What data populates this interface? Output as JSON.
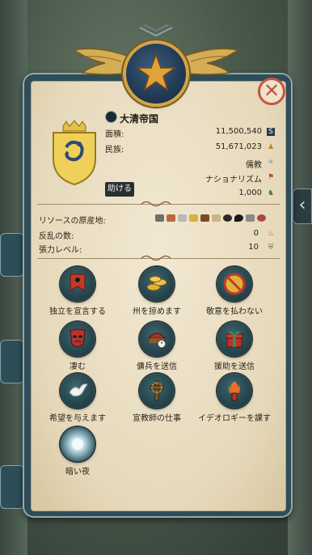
{
  "nation": {
    "name": "大清帝国",
    "help_button": "助ける"
  },
  "stats": [
    {
      "label": "面積:",
      "value": "11,500,540",
      "icon": "area-icon"
    },
    {
      "label": "民族:",
      "value": "51,671,023",
      "icon": "population-icon"
    },
    {
      "label": "",
      "value": "儒教",
      "icon": "religion-icon"
    },
    {
      "label": "",
      "value": "ナショナリズム",
      "icon": "ideology-flag-icon"
    },
    {
      "label": "",
      "value": "1,000",
      "icon": "army-icon"
    }
  ],
  "resources": {
    "label": "リソースの原産地:",
    "items": [
      "iron",
      "copper",
      "silver",
      "gold",
      "wood",
      "cloth",
      "coal",
      "oil",
      "stone",
      "meat"
    ]
  },
  "rebellion": {
    "label": "反乱の数:",
    "value": "0"
  },
  "power": {
    "label": "張力レベル:",
    "value": "10"
  },
  "actions": [
    {
      "label": "独立を宣言する",
      "icon": "banner-icon"
    },
    {
      "label": "州を掠めます",
      "icon": "coins-icon"
    },
    {
      "label": "敬意を払わない",
      "icon": "no-tribute-icon"
    },
    {
      "label": "凄む",
      "icon": "mask-icon"
    },
    {
      "label": "傭兵を送信",
      "icon": "mercenary-icon"
    },
    {
      "label": "援助を送信",
      "icon": "gift-icon"
    },
    {
      "label": "希望を与えます",
      "icon": "dove-icon"
    },
    {
      "label": "宣教師の仕事",
      "icon": "cross-icon"
    },
    {
      "label": "イデオロギーを課す",
      "icon": "torch-icon"
    },
    {
      "label": "暗い夜",
      "icon": "moon-glow-icon"
    }
  ],
  "colors": {
    "panel": "#2e4d58",
    "parchment": "#efe3cb",
    "gold": "#cfa64a",
    "close_red": "#c55540"
  }
}
